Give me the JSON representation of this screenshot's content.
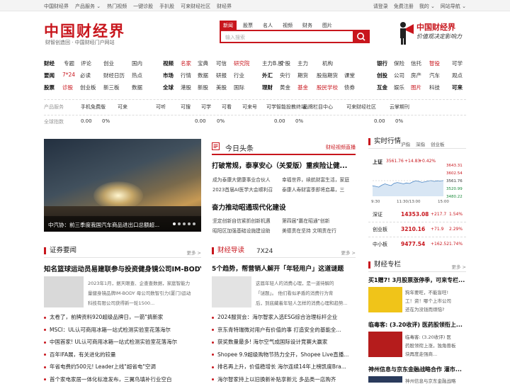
{
  "topbar": {
    "left": [
      "中国财经界",
      "产品服务 ⌄",
      "热门视频",
      "一键诊股",
      "手扒股",
      "可来财经社区",
      "财经界"
    ],
    "right": [
      "请登录",
      "免费注册",
      "我的 ⌄",
      "网站导航 ⌄"
    ]
  },
  "header": {
    "logo": "中国财经界",
    "slogan": "财智创造回 · 中国财经门户网站",
    "search_tabs": [
      "新闻",
      "股票",
      "名人",
      "视频",
      "财务",
      "图片"
    ],
    "search_placeholder": "输入搜索",
    "brand_title": "中国财经界",
    "brand_tag": "价值观决定影响力"
  },
  "nav": {
    "row1": [
      [
        "财经",
        "nred nb"
      ],
      [
        "专题",
        ""
      ],
      [
        "评论",
        ""
      ],
      [
        "创业",
        ""
      ],
      [
        "国内",
        ""
      ],
      [
        "视频",
        "nred nb"
      ],
      [
        "名家",
        "nred"
      ],
      [
        "宝典",
        ""
      ],
      [
        "可信",
        ""
      ],
      [
        "研究院",
        "nred"
      ],
      [
        "主力B.股",
        ""
      ],
      [
        "个股",
        ""
      ],
      [
        "主力",
        ""
      ],
      [
        "机构",
        ""
      ],
      [
        "银行",
        "nb"
      ],
      [
        "保险",
        ""
      ],
      [
        "信托",
        ""
      ],
      [
        "智投",
        "nred"
      ],
      [
        "可学",
        ""
      ]
    ],
    "row2": [
      [
        "要闻",
        "nb"
      ],
      [
        "7*24",
        "nred"
      ],
      [
        "必读",
        ""
      ],
      [
        "财经日历",
        ""
      ],
      [
        "热点",
        ""
      ],
      [
        "市场",
        "nb"
      ],
      [
        "行情",
        ""
      ],
      [
        "数据",
        ""
      ],
      [
        "研报",
        ""
      ],
      [
        "行业",
        ""
      ],
      [
        "外汇",
        "nb"
      ],
      [
        "央行",
        ""
      ],
      [
        "期货",
        ""
      ],
      [
        "股指期货",
        ""
      ],
      [
        "课堂",
        ""
      ],
      [
        "创投",
        "nb"
      ],
      [
        "公司",
        ""
      ],
      [
        "房产",
        ""
      ],
      [
        "汽车",
        ""
      ],
      [
        "观点",
        ""
      ]
    ],
    "row3": [
      [
        "股票",
        "nb"
      ],
      [
        "诊股",
        "nred"
      ],
      [
        "创业板",
        ""
      ],
      [
        "新三板",
        ""
      ],
      [
        "数据",
        ""
      ],
      [
        "全球",
        "nb"
      ],
      [
        "港股",
        ""
      ],
      [
        "新股",
        ""
      ],
      [
        "美股",
        ""
      ],
      [
        "国际",
        ""
      ],
      [
        "理财",
        "nb"
      ],
      [
        "黄金",
        ""
      ],
      [
        "基金",
        "nred"
      ],
      [
        "股民学校",
        "nred"
      ],
      [
        "债券",
        ""
      ],
      [
        "互金",
        "nb"
      ],
      [
        "娱乐",
        ""
      ],
      [
        "图片",
        "nred"
      ],
      [
        "科技",
        ""
      ],
      [
        "可来",
        "nred nb"
      ]
    ]
  },
  "services": {
    "label": "产品服务",
    "items": [
      "手机免费版",
      "可来",
      "可听",
      "可搜",
      "可学",
      "可看",
      "可来号",
      "可学智能投教终端",
      "品牌栏目中心",
      "可来财经社区",
      "云掌期刊"
    ]
  },
  "indices": {
    "label": "全球指数",
    "items": [
      "0.00",
      "0%",
      "0.00",
      "0%",
      "0.00",
      "0%",
      "0.00",
      "0%"
    ]
  },
  "hero": {
    "caption": "中汽协：前三季度我国汽车商品进出口总额超..."
  },
  "today": {
    "title": "今日头条",
    "more": "财经视频直播",
    "h1": "打破常规，泰享安心（关爱版）重疾险让健...",
    "s1": [
      "成为泰康大健康事业合伙人",
      "幸福世界，续航财富生活，家庭"
    ],
    "s2": [
      "2023首届AI医学大会顺利召",
      "泰康人寿财富季即将启幕，三"
    ],
    "h2": "奋力推动昭通现代化建设",
    "s3": [
      "坚定创新自信紧抓创新机遇",
      "第四届\"赢在昭通\"创新"
    ],
    "s4": [
      "昭阳区加强基础设施建设助",
      "美德责在坚持 文明责在行"
    ]
  },
  "market": {
    "title": "实时行情",
    "tabs": [
      "沪指",
      "深指",
      "创业板"
    ],
    "index_name": "上证",
    "index_val": "3561.76",
    "index_chg": "+14.83",
    "index_pct": "+0.42%",
    "ylabels": [
      "3643.31",
      "3602.54",
      "3561.76",
      "3520.99",
      "3480.22"
    ],
    "xlabels": [
      "9:30",
      "11:30/13:00",
      "15:00"
    ],
    "rows": [
      {
        "name": "深证",
        "val": "14353.08",
        "chg": "+217.7",
        "pct": "1.54%"
      },
      {
        "name": "创业板",
        "val": "3210.16",
        "chg": "+71.9",
        "pct": "2.29%"
      },
      {
        "name": "中小板",
        "val": "9477.54",
        "chg": "+162.52",
        "pct": "1.74%"
      }
    ]
  },
  "securities": {
    "title": "证券要闻",
    "more": "更多 >",
    "headline": "知名篮球运动员易建联参与投资健身镜公司IM-BODY...",
    "summary": [
      "2023年1月，据天眼查、企查查数据，家庭智能力",
      "量健身镜品牌IM-BODY 母公司数智引力(厦门)运动",
      "科技有限公司获得新一轮1500..."
    ],
    "list": [
      "太卷了，前牌资料920超级品牌日，一箭\"搞新家",
      "MSCI：UL认可商用冰箱一站式检测实验室花落海尔",
      "中国首家! UL认可商用冰箱一站式检测实验室花落海尔",
      "百年IFA展，有关进化的较量",
      "年省电费约500元! Leader上线\"超省电\"空调",
      "首个家电家居一体化标准发布，三翼鸟填补行业空白"
    ]
  },
  "guide": {
    "title": "财经导读",
    "title2": "7X24",
    "more": "更多 >",
    "headline": "5个趋势，帮营销人解开「年轻用户」这道谜题",
    "summary": [
      "这届年轻人的消费心理，是一道待解的",
      "「谜题」。    他们看似矛盾的消费行为背",
      "后，到底藏着年轻人怎样的消费心理和趋势..."
    ],
    "list": [
      "2024服贸会：海尔智家入选ESG综合治理标杆企业",
      "京东青特瑞微对用户有价值的事 打造安全的基能全...",
      "获奖数量最多! 海尔空气成国际设计竞赛大赢家",
      "Shopee 9.9超级购物节热力全开，Shopee Live直播...",
      "排名再上升，价值稳增长 海尔连续14年上榜凯度Bra...",
      "海尔智家持上以旧换新补贴享新元 多品类一店购齐"
    ]
  },
  "column": {
    "title": "财经专栏",
    "more": "更多 >",
    "a1_title": "买1赠7! 3月股票涨停季，可来专栏...",
    "a1_body": [
      "狗年要旺，不能盲旺!",
      "工！资！哪个上市公司",
      "还在为没钱而烦恼?"
    ],
    "a2_title": "临毒客: (3.20收评) 医药股领衔上...",
    "a2_body": [
      "临毒客: (3.20收评) 医",
      "药股领衔上涨，独角兽板",
      "块再度走强商..."
    ],
    "a3_title": "神州信息与京东金融战略合作 灌市...",
    "a3_body": [
      "神州信息与京东金融战略"
    ]
  }
}
